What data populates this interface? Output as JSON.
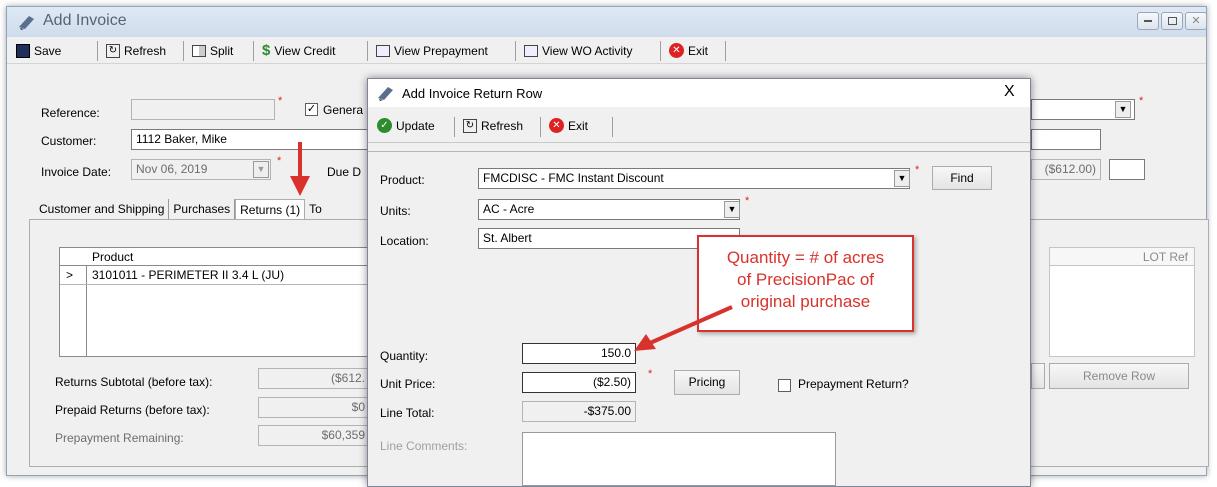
{
  "window": {
    "title": "Add Invoice"
  },
  "toolbar": {
    "save": "Save",
    "refresh": "Refresh",
    "split": "Split",
    "view_credit": "View Credit",
    "view_prepayment": "View Prepayment",
    "view_wo_activity": "View WO Activity",
    "exit": "Exit"
  },
  "header": {
    "reference_label": "Reference:",
    "reference_value": "",
    "general_label": "Genera",
    "customer_label": "Customer:",
    "customer_value": "1112 Baker, Mike",
    "invoice_date_label": "Invoice Date:",
    "invoice_date_value": "Nov 06, 2019",
    "due_label": "Due D",
    "total_value": "($612.00)"
  },
  "tabs": [
    "Customer and Shipping",
    "Purchases",
    "Returns (1)",
    "To"
  ],
  "returns_grid": {
    "columns": [
      "Product"
    ],
    "rows": [
      {
        "marker": ">",
        "product": "3101011 - PERIMETER II 3.4 L (JU)"
      }
    ],
    "lot_ref_header": "LOT Ref"
  },
  "summary": {
    "returns_subtotal_label": "Returns Subtotal (before tax):",
    "returns_subtotal_value": "($612.",
    "prepaid_returns_label": "Prepaid Returns (before tax):",
    "prepaid_returns_value": "$0",
    "prepayment_remaining_label": "Prepayment Remaining:",
    "prepayment_remaining_value": "$60,359"
  },
  "remove_row": "Remove Row",
  "dialog": {
    "title": "Add Invoice Return Row",
    "close": "X",
    "toolbar": {
      "update": "Update",
      "refresh": "Refresh",
      "exit": "Exit"
    },
    "product_label": "Product:",
    "product_value": "FMCDISC - FMC Instant Discount",
    "find": "Find",
    "units_label": "Units:",
    "units_value": "AC - Acre",
    "location_label": "Location:",
    "location_value": "St. Albert",
    "quantity_label": "Quantity:",
    "quantity_value": "150.0",
    "unit_price_label": "Unit Price:",
    "unit_price_value": "($2.50)",
    "pricing": "Pricing",
    "prepayment_return_label": "Prepayment Return?",
    "line_total_label": "Line Total:",
    "line_total_value": "-$375.00",
    "line_comments_label": "Line Comments:"
  },
  "annotation": {
    "callout_lines": [
      "Quantity = # of acres",
      "of PrecisionPac of",
      "original purchase"
    ],
    "color": "#d9322c"
  }
}
